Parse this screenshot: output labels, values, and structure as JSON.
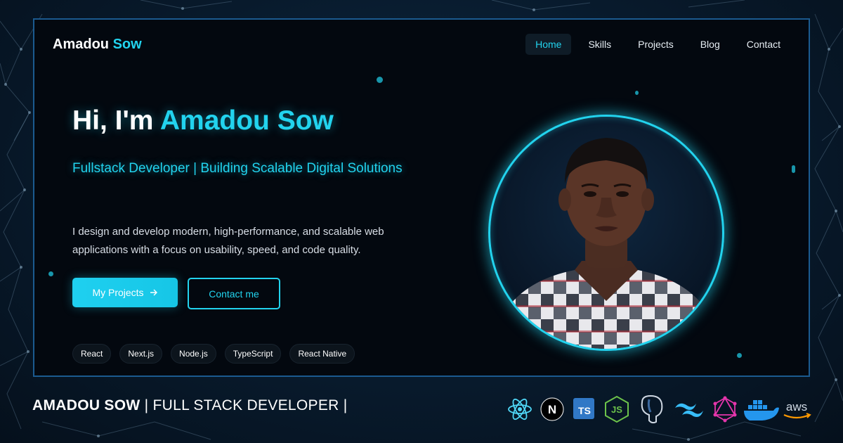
{
  "header": {
    "logo_first": "Amadou",
    "logo_second": "Sow",
    "nav": [
      {
        "label": "Home",
        "active": true
      },
      {
        "label": "Skills"
      },
      {
        "label": "Projects"
      },
      {
        "label": "Blog"
      },
      {
        "label": "Contact"
      }
    ]
  },
  "hero": {
    "greeting": "Hi, I'm",
    "name": "Amadou Sow",
    "subtitle": "Fullstack Developer | Building Scalable Digital Solutions",
    "description": "I design and develop modern, high-performance, and scalable web applications with a focus on usability, speed, and code quality.",
    "primary_button": "My Projects",
    "secondary_button": "Contact me",
    "tags": [
      "React",
      "Next.js",
      "Node.js",
      "TypeScript",
      "React Native"
    ]
  },
  "caption": {
    "name": "AMADOU SOW",
    "role": "| FULL STACK DEVELOPER |"
  },
  "tech_icons": [
    "react-icon",
    "nextjs-icon",
    "typescript-icon",
    "nodejs-icon",
    "postgresql-icon",
    "tailwind-icon",
    "graphql-icon",
    "docker-icon",
    "aws-icon"
  ],
  "tech_icon_text": {
    "next": "N",
    "ts": "TS",
    "js": "JS",
    "aws": "aws"
  },
  "colors": {
    "accent": "#22d3ee",
    "frame_border": "#1b5a8f",
    "background": "#081a2c"
  }
}
